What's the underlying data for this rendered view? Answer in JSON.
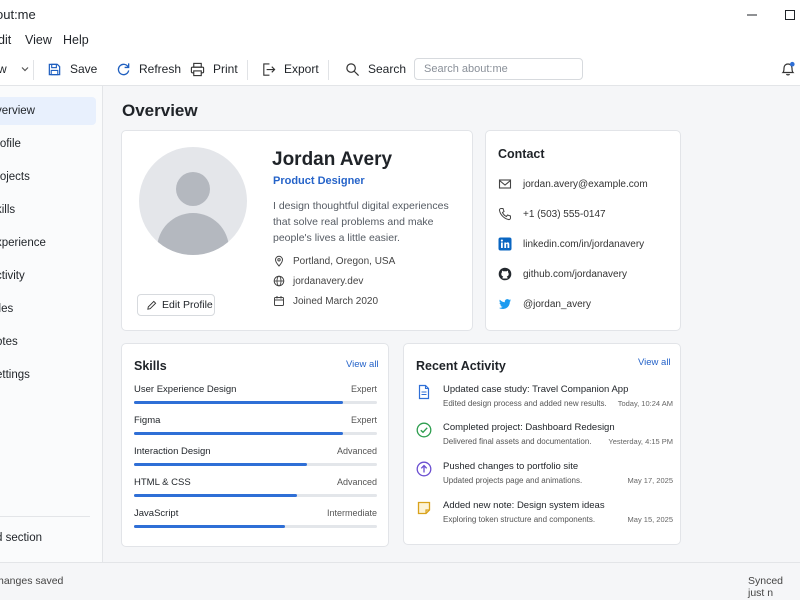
{
  "window": {
    "title": "out:me"
  },
  "menu": {
    "items": [
      "dit",
      "View",
      "Help"
    ]
  },
  "toolbar": {
    "new_label": "w",
    "save_label": "Save",
    "refresh_label": "Refresh",
    "print_label": "Print",
    "export_label": "Export",
    "search_label": "Search",
    "search_placeholder": "Search about:me"
  },
  "sidebar": {
    "items": [
      {
        "label": "verview",
        "active": true
      },
      {
        "label": "rofile"
      },
      {
        "label": "rojects"
      },
      {
        "label": "kills"
      },
      {
        "label": "xperience"
      },
      {
        "label": "ctivity"
      },
      {
        "label": "iles"
      },
      {
        "label": "otes"
      },
      {
        "label": "ettings"
      }
    ],
    "add_section": "d section"
  },
  "status": {
    "left": "hanges saved",
    "right": "Synced just n"
  },
  "page": {
    "title": "Overview"
  },
  "profile": {
    "name": "Jordan Avery",
    "role": "Product Designer",
    "bio": "I design thoughtful digital experiences that solve real problems and make people's lives a little easier.",
    "location": "Portland, Oregon, USA",
    "website": "jordanavery.dev",
    "joined": "Joined March 2020",
    "edit_label": "Edit Profile"
  },
  "contact": {
    "title": "Contact",
    "email": "jordan.avery@example.com",
    "phone": "+1 (503) 555-0147",
    "linkedin": "linkedin.com/in/jordanavery",
    "github": "github.com/jordanavery",
    "twitter": "@jordan_avery"
  },
  "skills": {
    "title": "Skills",
    "view_all": "View all",
    "items": [
      {
        "name": "User Experience Design",
        "level": "Expert",
        "progress": 0.86
      },
      {
        "name": "Figma",
        "level": "Expert",
        "progress": 0.86
      },
      {
        "name": "Interaction Design",
        "level": "Advanced",
        "progress": 0.71
      },
      {
        "name": "HTML & CSS",
        "level": "Advanced",
        "progress": 0.67
      },
      {
        "name": "JavaScript",
        "level": "Intermediate",
        "progress": 0.62
      }
    ]
  },
  "activity": {
    "title": "Recent Activity",
    "view_all": "View all",
    "items": [
      {
        "icon": "document-icon",
        "title": "Updated case study: Travel Companion App",
        "desc": "Edited design process and added new results.",
        "time": "Today, 10:24 AM",
        "color": "#2f6fd6"
      },
      {
        "icon": "check-circle-icon",
        "title": "Completed project: Dashboard Redesign",
        "desc": "Delivered final assets and documentation.",
        "time": "Yesterday, 4:15 PM",
        "color": "#2e9e4f"
      },
      {
        "icon": "upload-circle-icon",
        "title": "Pushed changes to portfolio site",
        "desc": "Updated projects page and animations.",
        "time": "May 17, 2025",
        "color": "#6b4fd1"
      },
      {
        "icon": "sticky-note-icon",
        "title": "Added new note: Design system ideas",
        "desc": "Exploring token structure and components.",
        "time": "May 15, 2025",
        "color": "#d9a21b"
      }
    ]
  },
  "colors": {
    "accent": "#2563c9",
    "skill_bar": "#2f6fd6",
    "notification_dot": "#2f6fd6"
  }
}
